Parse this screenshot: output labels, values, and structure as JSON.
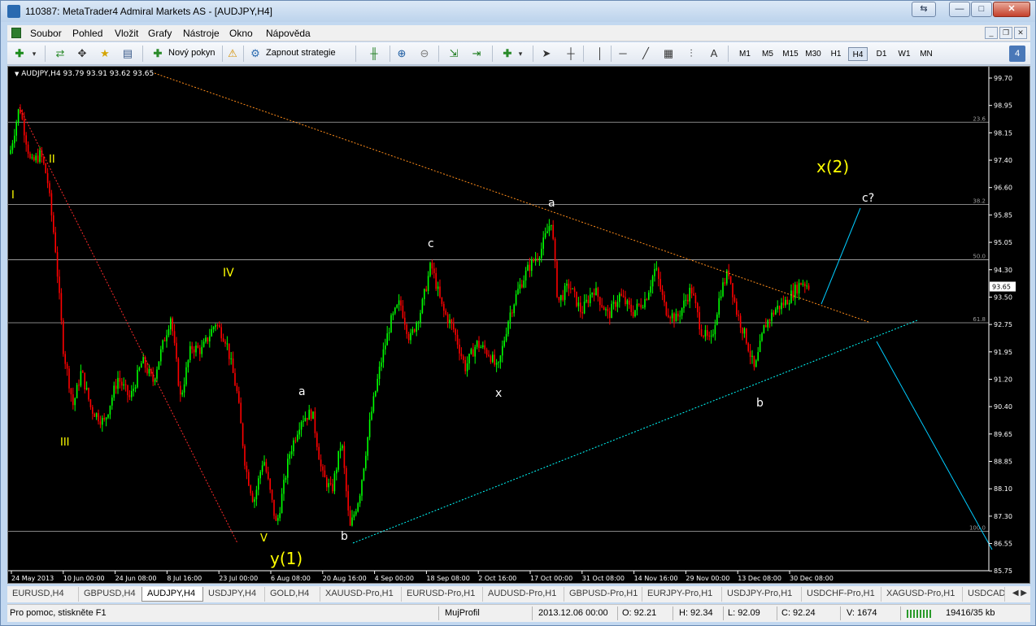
{
  "window": {
    "title": "110387: MetaTrader4 Admiral Markets AS - [AUDJPY,H4]",
    "controls": {
      "extra": "⇆",
      "minimize": "—",
      "maximize": "□",
      "close": "✕"
    }
  },
  "menu": {
    "items": [
      "Soubor",
      "Pohled",
      "Vložit",
      "Grafy",
      "Nástroje",
      "Okno",
      "Nápověda"
    ],
    "mdi_controls": [
      "_",
      "❐",
      "✕"
    ]
  },
  "toolbar": {
    "new_order_label": "Nový pokyn",
    "autotrading_label": "Zapnout strategie",
    "timeframes": [
      "M1",
      "M5",
      "M15",
      "M30",
      "H1",
      "H4",
      "D1",
      "W1",
      "MN"
    ],
    "active_timeframe": "H4",
    "text_tool": "A",
    "badge": "4"
  },
  "chart": {
    "header": "AUDJPY,H4  93.79 93.91 93.62 93.65",
    "current_price": "93.65",
    "price_ticks": [
      "99.70",
      "98.95",
      "98.15",
      "97.40",
      "96.60",
      "95.85",
      "95.05",
      "94.30",
      "93.50",
      "92.75",
      "91.95",
      "91.20",
      "90.40",
      "89.65",
      "88.85",
      "88.10",
      "87.30",
      "86.55",
      "85.75"
    ],
    "time_ticks": [
      "24 May 2013",
      "10 Jun 00:00",
      "24 Jun 08:00",
      "8 Jul 16:00",
      "23 Jul 00:00",
      "6 Aug 08:00",
      "20 Aug 16:00",
      "4 Sep 00:00",
      "18 Sep 08:00",
      "2 Oct 16:00",
      "17 Oct 00:00",
      "31 Oct 08:00",
      "14 Nov 16:00",
      "29 Nov 00:00",
      "13 Dec 08:00",
      "30 Dec 08:00"
    ],
    "fib_levels": [
      "23.6",
      "38.2",
      "50.0",
      "61.8",
      "100.0"
    ],
    "wave_labels_yellow": [
      "I",
      "II",
      "III",
      "IV",
      "V",
      "y(1)",
      "x(2)"
    ],
    "wave_labels_white": [
      "a",
      "b",
      "c",
      "a",
      "x",
      "b",
      "c?"
    ],
    "colors": {
      "bull_candle": "#00ff00",
      "bear_candle": "#ff0000",
      "wave_yellow": "#ffff00",
      "trendline_top": "#ff8c1a",
      "trendline_left": "#ff2a2a",
      "trendline_bottom": "#00ffff",
      "projection": "#00ccff",
      "fib_line": "#b0b0b0"
    }
  },
  "tabs": [
    "EURUSD,H4",
    "GBPUSD,H4",
    "AUDJPY,H4",
    "USDJPY,H4",
    "GOLD,H4",
    "XAUUSD-Pro,H1",
    "EURUSD-Pro,H1",
    "AUDUSD-Pro,H1",
    "GBPUSD-Pro,H1",
    "EURJPY-Pro,H1",
    "USDJPY-Pro,H1",
    "USDCHF-Pro,H1",
    "XAGUSD-Pro,H1",
    "USDCAD"
  ],
  "active_tab": "AUDJPY,H4",
  "status": {
    "help": "Pro pomoc, stiskněte F1",
    "profile": "MujProfil",
    "datetime": "2013.12.06 00:00",
    "open": "O: 92.21",
    "high": "H: 92.34",
    "low": "L: 92.09",
    "close": "C: 92.24",
    "volume": "V: 1674",
    "traffic": "19416/35 kb"
  }
}
